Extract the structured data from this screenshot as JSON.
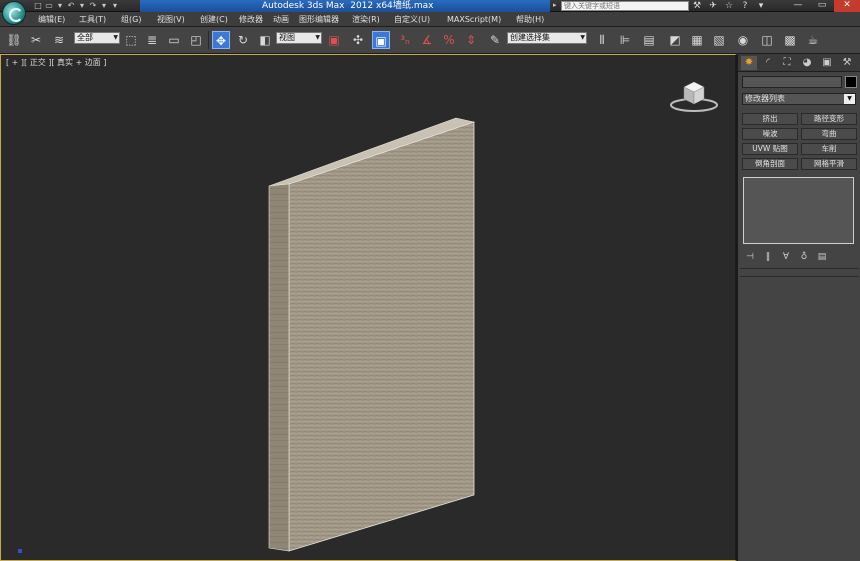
{
  "titlebar": {
    "app_title": "Autodesk 3ds Max  2012 x64",
    "file_name": "墙纸.max",
    "search_placeholder": "键入关键字或短语",
    "quick_access": [
      "□",
      "▭",
      "▾",
      "↶",
      "▾",
      "↷",
      "▾",
      "▾"
    ],
    "right_icons": [
      "⚒",
      "✈",
      "☆",
      "?",
      "▾"
    ],
    "window_controls": [
      "—",
      "▭",
      "✕"
    ]
  },
  "menu": {
    "items": [
      "编辑(E)",
      "工具(T)",
      "组(G)",
      "视图(V)",
      "创建(C)",
      "修改器",
      "动画",
      "图形编辑器",
      "渲染(R)",
      "自定义(U)",
      "MAXScript(M)",
      "帮助(H)"
    ]
  },
  "toolbar": {
    "selection_filter": "全部",
    "ref_coord": "视图",
    "named_selection": "创建选择集",
    "icons": [
      "link-icon",
      "unlink-icon",
      "bind-spacewarp-icon",
      "select-object-icon",
      "select-by-name-icon",
      "rect-region-icon",
      "window-crossing-icon",
      "select-move-icon",
      "select-rotate-icon",
      "select-scale-icon",
      "pivot-icon",
      "mirror-icon",
      "align-icon"
    ]
  },
  "viewport": {
    "label": "[ + ][ 正交 ][ 真实 + 边面 ]"
  },
  "panel": {
    "modifier_list": "修改器列表",
    "buttons": [
      "挤出",
      "路径变形",
      "噪波",
      "弯曲",
      "UVW 贴图",
      "车削",
      "倒角剖面",
      "网格平滑"
    ],
    "tabs": [
      "create-tab-icon",
      "modify-tab-icon",
      "hierarchy-tab-icon",
      "motion-tab-icon",
      "display-tab-icon",
      "utilities-tab-icon"
    ]
  },
  "colors": {
    "title_band": "#1a4f9a",
    "active_button": "#3b78d8",
    "viewport_border": "#c9a84a",
    "wall_texture": "#9b9080",
    "close_button": "#c43b2b"
  }
}
